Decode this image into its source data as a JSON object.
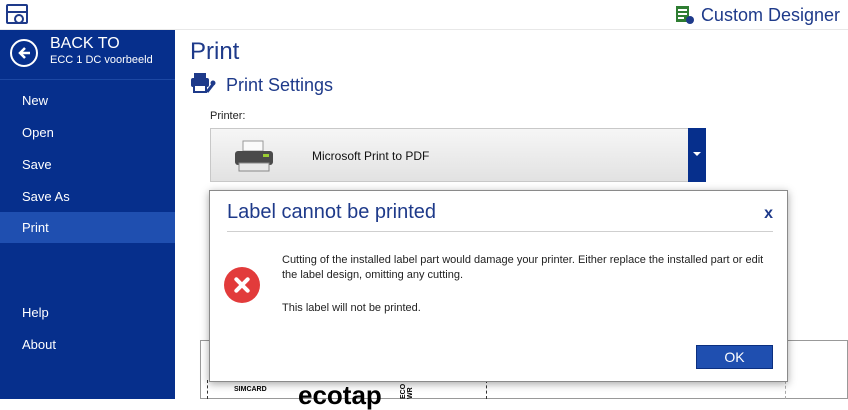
{
  "app": {
    "brand": "Custom Designer"
  },
  "sidebar": {
    "back_title": "BACK TO",
    "back_subtitle": "ECC 1 DC voorbeeld",
    "items": [
      {
        "label": "New"
      },
      {
        "label": "Open"
      },
      {
        "label": "Save"
      },
      {
        "label": "Save As"
      },
      {
        "label": "Print",
        "active": true
      },
      {
        "label": "Help"
      },
      {
        "label": "About"
      }
    ]
  },
  "main": {
    "title": "Print",
    "section_title": "Print Settings",
    "printer_label": "Printer:",
    "printer_name": "Microsoft Print to PDF"
  },
  "preview": {
    "sim_text": "SIMCARD",
    "big_text": "ecotap",
    "vertical_text": "ECO WR"
  },
  "dialog": {
    "title": "Label cannot be printed",
    "close_label": "x",
    "message_line1": "Cutting of the installed label part would damage your printer.  Either replace the installed part or edit the label design, omitting any cutting.",
    "message_line2": "This label will not be printed.",
    "ok_label": "OK"
  },
  "colors": {
    "sidebar_bg": "#062f8c",
    "accent": "#1e3a8a",
    "error": "#e23b3b",
    "button": "#1f4fb0"
  }
}
